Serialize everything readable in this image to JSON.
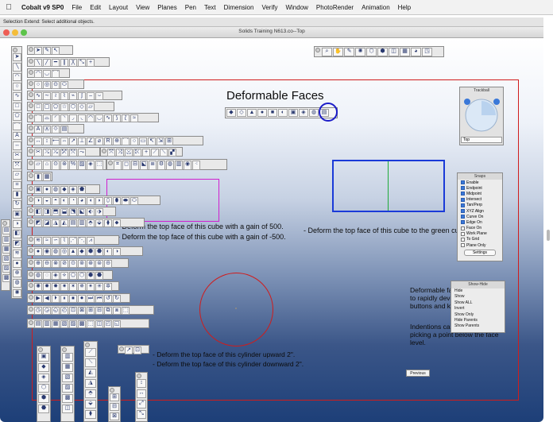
{
  "menubar": {
    "app_name": "Cobalt v9 SP0",
    "items": [
      "File",
      "Edit",
      "Layout",
      "View",
      "Planes",
      "Pen",
      "Text",
      "Dimension",
      "Verify",
      "Window",
      "PhotoRender",
      "Animation",
      "Help"
    ]
  },
  "status_line": "Selection Extend: Select additional objects.",
  "window": {
    "title": "Solids Training N613.co--Top"
  },
  "drawing": {
    "heading": "Deformable Faces",
    "cube_gain_500": "- Deform the top face of this cube with a gain of 500.",
    "cube_gain_neg500": "- Deform the top face of this cube with a gain of -500.",
    "cube_curve": "- Deform the top face of this cube to the green curve.",
    "cylinder_up": "- Deform the top face of this cylinder upward 2\".",
    "cylinder_down": "- Deform the top face of this cylinder downward 2\".",
    "tip_text_1": "Deformable faces can be used to rapidly develop \"swoopy\" buttons and knobs.",
    "tip_text_2": "Indentions can be made by picking a point below the face level.",
    "previous_button": "Previous",
    "colors": {
      "magenta": "#d020d0",
      "blue": "#1a3ad8",
      "green": "#1faa3a",
      "red": "#d01c1c",
      "blue_circle": "#1c1cc8"
    }
  },
  "snaps": {
    "title": "Snaps",
    "items": [
      {
        "label": "Enable",
        "checked": true
      },
      {
        "label": "Endpoint",
        "checked": true
      },
      {
        "label": "Midpoint",
        "checked": true
      },
      {
        "label": "Intersect",
        "checked": true
      },
      {
        "label": "Tan/Perp",
        "checked": true
      },
      {
        "label": "XYZ Align",
        "checked": true
      },
      {
        "label": "Curve On",
        "checked": true
      },
      {
        "label": "Edge On",
        "checked": true
      },
      {
        "label": "Face On",
        "checked": false
      },
      {
        "label": "Work Plane",
        "checked": false
      },
      {
        "label": "To Grid",
        "checked": false
      },
      {
        "label": "Plane Only",
        "checked": false
      }
    ],
    "settings_label": "Settings"
  },
  "show_hide": {
    "title": "Show-Hide",
    "items": [
      "Hide",
      "Show",
      "Show ALL",
      "Invert",
      "Show Only",
      "Hide Parents",
      "Show Parents"
    ]
  },
  "trackball": {
    "title": "Trackball",
    "view": "Top"
  }
}
